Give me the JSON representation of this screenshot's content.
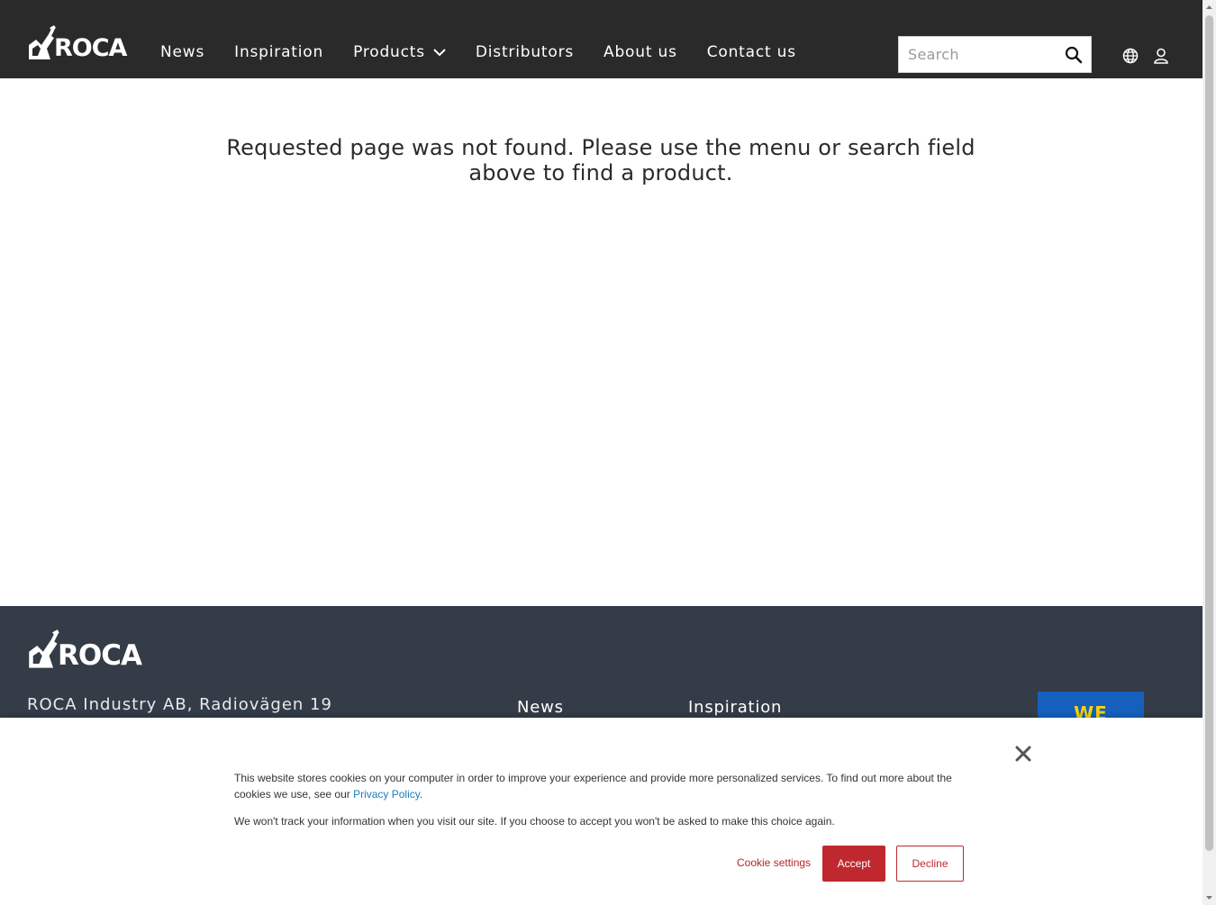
{
  "header": {
    "logo_text": "ROCA",
    "nav": {
      "news": "News",
      "inspiration": "Inspiration",
      "products": "Products",
      "distributors": "Distributors",
      "about": "About us",
      "contact": "Contact us"
    },
    "search": {
      "placeholder": "Search"
    },
    "icons": [
      "search-icon",
      "globe-icon",
      "user-icon",
      "chevron-down-icon"
    ]
  },
  "main": {
    "message": "Requested page was not found. Please use the menu or search field above to find a product."
  },
  "footer": {
    "logo_text": "ROCA",
    "address": "ROCA Industry AB, Radiovägen 19",
    "links": {
      "news": "News",
      "inspiration": "Inspiration"
    },
    "badge_text": "WE"
  },
  "cookie_banner": {
    "text1_before": "This website stores cookies on your computer in order to improve your experience and provide more personalized services. To find out more about the cookies we use, see our ",
    "privacy_link": "Privacy Policy",
    "text1_after": ".",
    "text2": "We won't track your information when you visit our site. If you choose to accept you won't be asked to make this choice again.",
    "settings_label": "Cookie settings",
    "accept_label": "Accept",
    "decline_label": "Decline"
  },
  "colors": {
    "header_bg": "#2a2a2b",
    "footer_bg": "#333c47",
    "accent_red": "#c0282f",
    "link_blue": "#1a7ec0",
    "badge_blue": "#1560bd",
    "badge_yellow": "#f5d20a"
  }
}
